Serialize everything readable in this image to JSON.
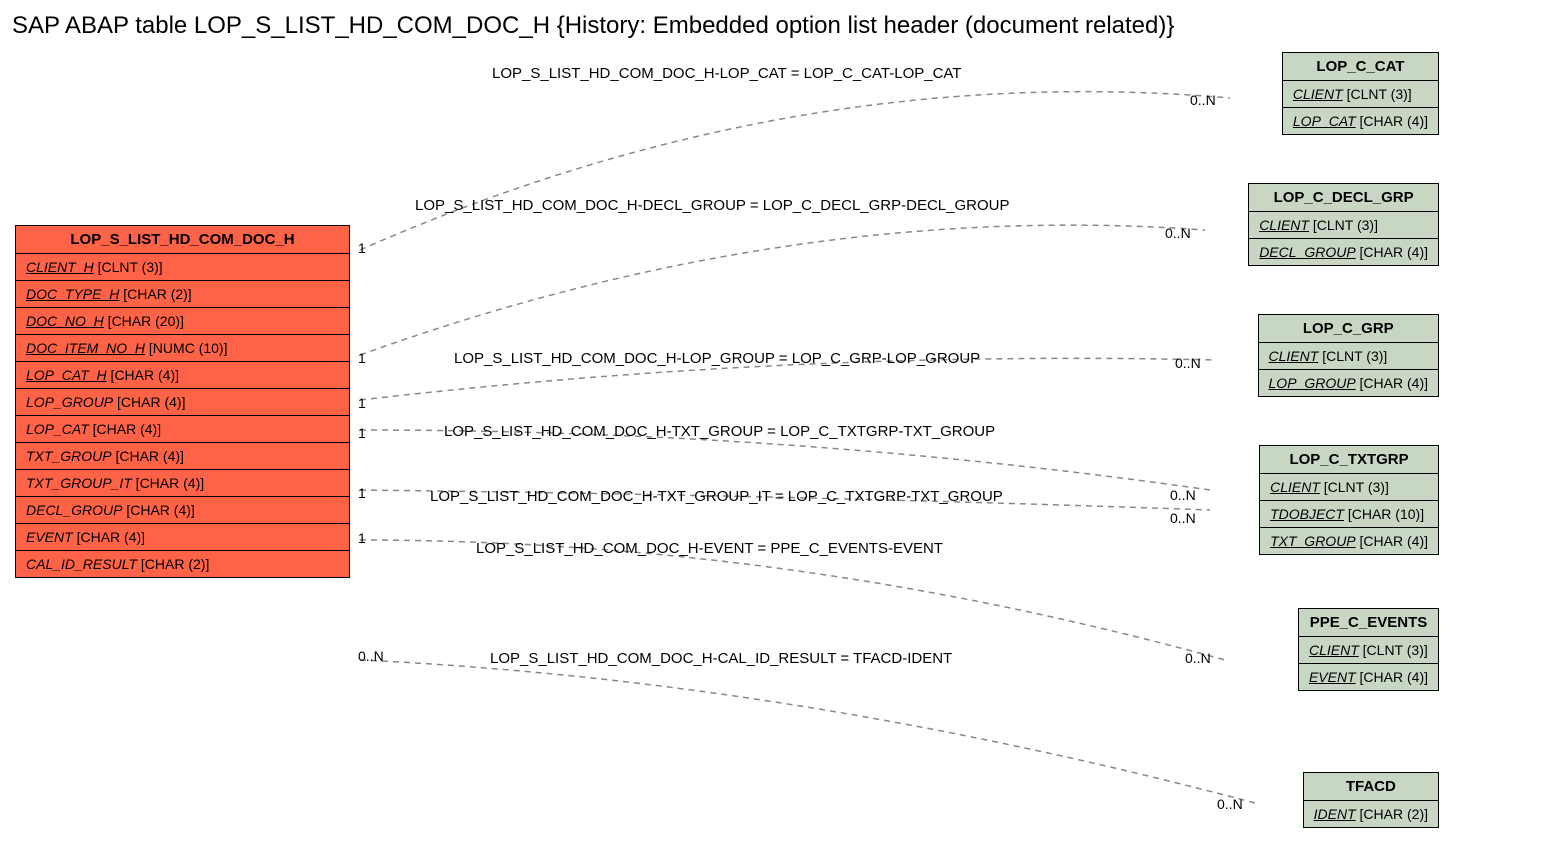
{
  "title": "SAP ABAP table LOP_S_LIST_HD_COM_DOC_H {History: Embedded option list header (document related)}",
  "main": {
    "name": "LOP_S_LIST_HD_COM_DOC_H",
    "fields": [
      {
        "n": "CLIENT_H",
        "t": " [CLNT (3)]",
        "u": true
      },
      {
        "n": "DOC_TYPE_H",
        "t": " [CHAR (2)]",
        "u": true
      },
      {
        "n": "DOC_NO_H",
        "t": " [CHAR (20)]",
        "u": true
      },
      {
        "n": "DOC_ITEM_NO_H",
        "t": " [NUMC (10)]",
        "u": true
      },
      {
        "n": "LOP_CAT_H",
        "t": " [CHAR (4)]",
        "u": true
      },
      {
        "n": "LOP_GROUP",
        "t": " [CHAR (4)]",
        "u": false
      },
      {
        "n": "LOP_CAT",
        "t": " [CHAR (4)]",
        "u": false
      },
      {
        "n": "TXT_GROUP",
        "t": " [CHAR (4)]",
        "u": false
      },
      {
        "n": "TXT_GROUP_IT",
        "t": " [CHAR (4)]",
        "u": false
      },
      {
        "n": "DECL_GROUP",
        "t": " [CHAR (4)]",
        "u": false
      },
      {
        "n": "EVENT",
        "t": " [CHAR (4)]",
        "u": false
      },
      {
        "n": "CAL_ID_RESULT",
        "t": " [CHAR (2)]",
        "u": false
      }
    ]
  },
  "refs": [
    {
      "name": "LOP_C_CAT",
      "fields": [
        {
          "n": "CLIENT",
          "t": " [CLNT (3)]",
          "u": true
        },
        {
          "n": "LOP_CAT",
          "t": " [CHAR (4)]",
          "u": true
        }
      ]
    },
    {
      "name": "LOP_C_DECL_GRP",
      "fields": [
        {
          "n": "CLIENT",
          "t": " [CLNT (3)]",
          "u": true
        },
        {
          "n": "DECL_GROUP",
          "t": " [CHAR (4)]",
          "u": true
        }
      ]
    },
    {
      "name": "LOP_C_GRP",
      "fields": [
        {
          "n": "CLIENT",
          "t": " [CLNT (3)]",
          "u": true
        },
        {
          "n": "LOP_GROUP",
          "t": " [CHAR (4)]",
          "u": true
        }
      ]
    },
    {
      "name": "LOP_C_TXTGRP",
      "fields": [
        {
          "n": "CLIENT",
          "t": " [CLNT (3)]",
          "u": true
        },
        {
          "n": "TDOBJECT",
          "t": " [CHAR (10)]",
          "u": true
        },
        {
          "n": "TXT_GROUP",
          "t": " [CHAR (4)]",
          "u": true
        }
      ]
    },
    {
      "name": "PPE_C_EVENTS",
      "fields": [
        {
          "n": "CLIENT",
          "t": " [CLNT (3)]",
          "u": true
        },
        {
          "n": "EVENT",
          "t": " [CHAR (4)]",
          "u": true
        }
      ]
    },
    {
      "name": "TFACD",
      "fields": [
        {
          "n": "IDENT",
          "t": " [CHAR (2)]",
          "u": true
        }
      ]
    }
  ],
  "relations": [
    {
      "label": "LOP_S_LIST_HD_COM_DOC_H-LOP_CAT = LOP_C_CAT-LOP_CAT",
      "lc": "1",
      "rc": "0..N"
    },
    {
      "label": "LOP_S_LIST_HD_COM_DOC_H-DECL_GROUP = LOP_C_DECL_GRP-DECL_GROUP",
      "lc": "1",
      "rc": "0..N"
    },
    {
      "label": "LOP_S_LIST_HD_COM_DOC_H-LOP_GROUP = LOP_C_GRP-LOP_GROUP",
      "lc": "1",
      "rc": "0..N"
    },
    {
      "label": "LOP_S_LIST_HD_COM_DOC_H-TXT_GROUP = LOP_C_TXTGRP-TXT_GROUP",
      "lc": "1",
      "rc": "0..N"
    },
    {
      "label": "LOP_S_LIST_HD_COM_DOC_H-TXT_GROUP_IT = LOP_C_TXTGRP-TXT_GROUP",
      "lc": "1",
      "rc": "0..N"
    },
    {
      "label": "LOP_S_LIST_HD_COM_DOC_H-EVENT = PPE_C_EVENTS-EVENT",
      "lc": "1",
      "rc": "0..N"
    },
    {
      "label": "LOP_S_LIST_HD_COM_DOC_H-CAL_ID_RESULT = TFACD-IDENT",
      "lc": "0..N",
      "rc": "0..N"
    }
  ]
}
